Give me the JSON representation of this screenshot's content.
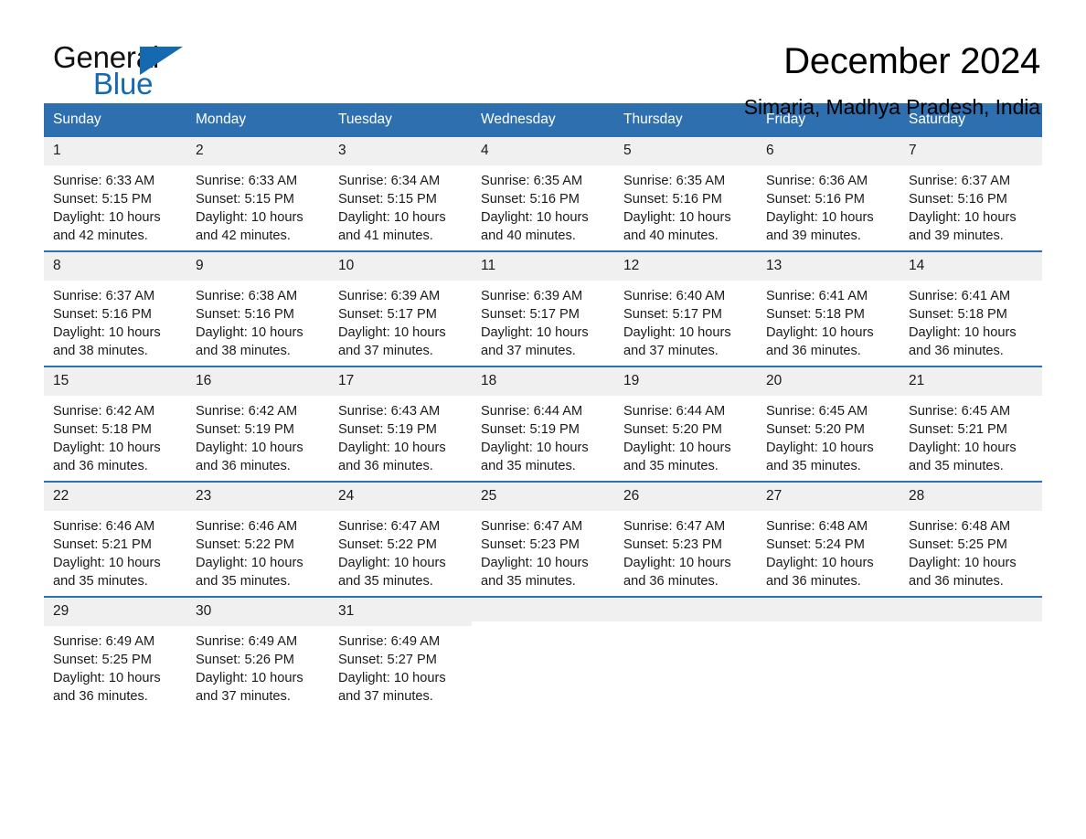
{
  "brand": {
    "name_part1": "General",
    "name_part2": "Blue",
    "accent_color": "#1469b0"
  },
  "header": {
    "title": "December 2024",
    "location": "Simaria, Madhya Pradesh, India"
  },
  "calendar": {
    "header_color": "#2e6fb0",
    "weekdays": [
      "Sunday",
      "Monday",
      "Tuesday",
      "Wednesday",
      "Thursday",
      "Friday",
      "Saturday"
    ],
    "weeks": [
      [
        {
          "day": "1",
          "sunrise": "Sunrise: 6:33 AM",
          "sunset": "Sunset: 5:15 PM",
          "daylight": "Daylight: 10 hours and 42 minutes."
        },
        {
          "day": "2",
          "sunrise": "Sunrise: 6:33 AM",
          "sunset": "Sunset: 5:15 PM",
          "daylight": "Daylight: 10 hours and 42 minutes."
        },
        {
          "day": "3",
          "sunrise": "Sunrise: 6:34 AM",
          "sunset": "Sunset: 5:15 PM",
          "daylight": "Daylight: 10 hours and 41 minutes."
        },
        {
          "day": "4",
          "sunrise": "Sunrise: 6:35 AM",
          "sunset": "Sunset: 5:16 PM",
          "daylight": "Daylight: 10 hours and 40 minutes."
        },
        {
          "day": "5",
          "sunrise": "Sunrise: 6:35 AM",
          "sunset": "Sunset: 5:16 PM",
          "daylight": "Daylight: 10 hours and 40 minutes."
        },
        {
          "day": "6",
          "sunrise": "Sunrise: 6:36 AM",
          "sunset": "Sunset: 5:16 PM",
          "daylight": "Daylight: 10 hours and 39 minutes."
        },
        {
          "day": "7",
          "sunrise": "Sunrise: 6:37 AM",
          "sunset": "Sunset: 5:16 PM",
          "daylight": "Daylight: 10 hours and 39 minutes."
        }
      ],
      [
        {
          "day": "8",
          "sunrise": "Sunrise: 6:37 AM",
          "sunset": "Sunset: 5:16 PM",
          "daylight": "Daylight: 10 hours and 38 minutes."
        },
        {
          "day": "9",
          "sunrise": "Sunrise: 6:38 AM",
          "sunset": "Sunset: 5:16 PM",
          "daylight": "Daylight: 10 hours and 38 minutes."
        },
        {
          "day": "10",
          "sunrise": "Sunrise: 6:39 AM",
          "sunset": "Sunset: 5:17 PM",
          "daylight": "Daylight: 10 hours and 37 minutes."
        },
        {
          "day": "11",
          "sunrise": "Sunrise: 6:39 AM",
          "sunset": "Sunset: 5:17 PM",
          "daylight": "Daylight: 10 hours and 37 minutes."
        },
        {
          "day": "12",
          "sunrise": "Sunrise: 6:40 AM",
          "sunset": "Sunset: 5:17 PM",
          "daylight": "Daylight: 10 hours and 37 minutes."
        },
        {
          "day": "13",
          "sunrise": "Sunrise: 6:41 AM",
          "sunset": "Sunset: 5:18 PM",
          "daylight": "Daylight: 10 hours and 36 minutes."
        },
        {
          "day": "14",
          "sunrise": "Sunrise: 6:41 AM",
          "sunset": "Sunset: 5:18 PM",
          "daylight": "Daylight: 10 hours and 36 minutes."
        }
      ],
      [
        {
          "day": "15",
          "sunrise": "Sunrise: 6:42 AM",
          "sunset": "Sunset: 5:18 PM",
          "daylight": "Daylight: 10 hours and 36 minutes."
        },
        {
          "day": "16",
          "sunrise": "Sunrise: 6:42 AM",
          "sunset": "Sunset: 5:19 PM",
          "daylight": "Daylight: 10 hours and 36 minutes."
        },
        {
          "day": "17",
          "sunrise": "Sunrise: 6:43 AM",
          "sunset": "Sunset: 5:19 PM",
          "daylight": "Daylight: 10 hours and 36 minutes."
        },
        {
          "day": "18",
          "sunrise": "Sunrise: 6:44 AM",
          "sunset": "Sunset: 5:19 PM",
          "daylight": "Daylight: 10 hours and 35 minutes."
        },
        {
          "day": "19",
          "sunrise": "Sunrise: 6:44 AM",
          "sunset": "Sunset: 5:20 PM",
          "daylight": "Daylight: 10 hours and 35 minutes."
        },
        {
          "day": "20",
          "sunrise": "Sunrise: 6:45 AM",
          "sunset": "Sunset: 5:20 PM",
          "daylight": "Daylight: 10 hours and 35 minutes."
        },
        {
          "day": "21",
          "sunrise": "Sunrise: 6:45 AM",
          "sunset": "Sunset: 5:21 PM",
          "daylight": "Daylight: 10 hours and 35 minutes."
        }
      ],
      [
        {
          "day": "22",
          "sunrise": "Sunrise: 6:46 AM",
          "sunset": "Sunset: 5:21 PM",
          "daylight": "Daylight: 10 hours and 35 minutes."
        },
        {
          "day": "23",
          "sunrise": "Sunrise: 6:46 AM",
          "sunset": "Sunset: 5:22 PM",
          "daylight": "Daylight: 10 hours and 35 minutes."
        },
        {
          "day": "24",
          "sunrise": "Sunrise: 6:47 AM",
          "sunset": "Sunset: 5:22 PM",
          "daylight": "Daylight: 10 hours and 35 minutes."
        },
        {
          "day": "25",
          "sunrise": "Sunrise: 6:47 AM",
          "sunset": "Sunset: 5:23 PM",
          "daylight": "Daylight: 10 hours and 35 minutes."
        },
        {
          "day": "26",
          "sunrise": "Sunrise: 6:47 AM",
          "sunset": "Sunset: 5:23 PM",
          "daylight": "Daylight: 10 hours and 36 minutes."
        },
        {
          "day": "27",
          "sunrise": "Sunrise: 6:48 AM",
          "sunset": "Sunset: 5:24 PM",
          "daylight": "Daylight: 10 hours and 36 minutes."
        },
        {
          "day": "28",
          "sunrise": "Sunrise: 6:48 AM",
          "sunset": "Sunset: 5:25 PM",
          "daylight": "Daylight: 10 hours and 36 minutes."
        }
      ],
      [
        {
          "day": "29",
          "sunrise": "Sunrise: 6:49 AM",
          "sunset": "Sunset: 5:25 PM",
          "daylight": "Daylight: 10 hours and 36 minutes."
        },
        {
          "day": "30",
          "sunrise": "Sunrise: 6:49 AM",
          "sunset": "Sunset: 5:26 PM",
          "daylight": "Daylight: 10 hours and 37 minutes."
        },
        {
          "day": "31",
          "sunrise": "Sunrise: 6:49 AM",
          "sunset": "Sunset: 5:27 PM",
          "daylight": "Daylight: 10 hours and 37 minutes."
        },
        {
          "day": "",
          "sunrise": "",
          "sunset": "",
          "daylight": ""
        },
        {
          "day": "",
          "sunrise": "",
          "sunset": "",
          "daylight": ""
        },
        {
          "day": "",
          "sunrise": "",
          "sunset": "",
          "daylight": ""
        },
        {
          "day": "",
          "sunrise": "",
          "sunset": "",
          "daylight": ""
        }
      ]
    ]
  }
}
